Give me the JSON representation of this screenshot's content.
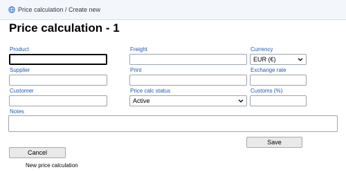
{
  "breadcrumb": {
    "text": "Price calculation / Create new",
    "icon": "globe-icon"
  },
  "title": "Price calculation - 1",
  "labels": {
    "product": "Product",
    "freight": "Freight",
    "currency": "Currency",
    "supplier": "Supplier",
    "print": "Print",
    "exchange_rate": "Exchange rate",
    "customer": "Customer",
    "price_calc_status": "Price calc status",
    "customs": "Customs (%)",
    "notes": "Notes"
  },
  "values": {
    "product": "",
    "freight": "",
    "supplier": "",
    "print": "",
    "exchange_rate": "",
    "customer": "",
    "customs": "",
    "notes": ""
  },
  "selects": {
    "currency": "EUR (€)",
    "price_calc_status": "Active"
  },
  "buttons": {
    "save": "Save",
    "cancel": "Cancel"
  },
  "footer": {
    "status_text": "New price calculation"
  },
  "colors": {
    "label": "#1f57b5",
    "topbar": "#f3f6fb"
  }
}
